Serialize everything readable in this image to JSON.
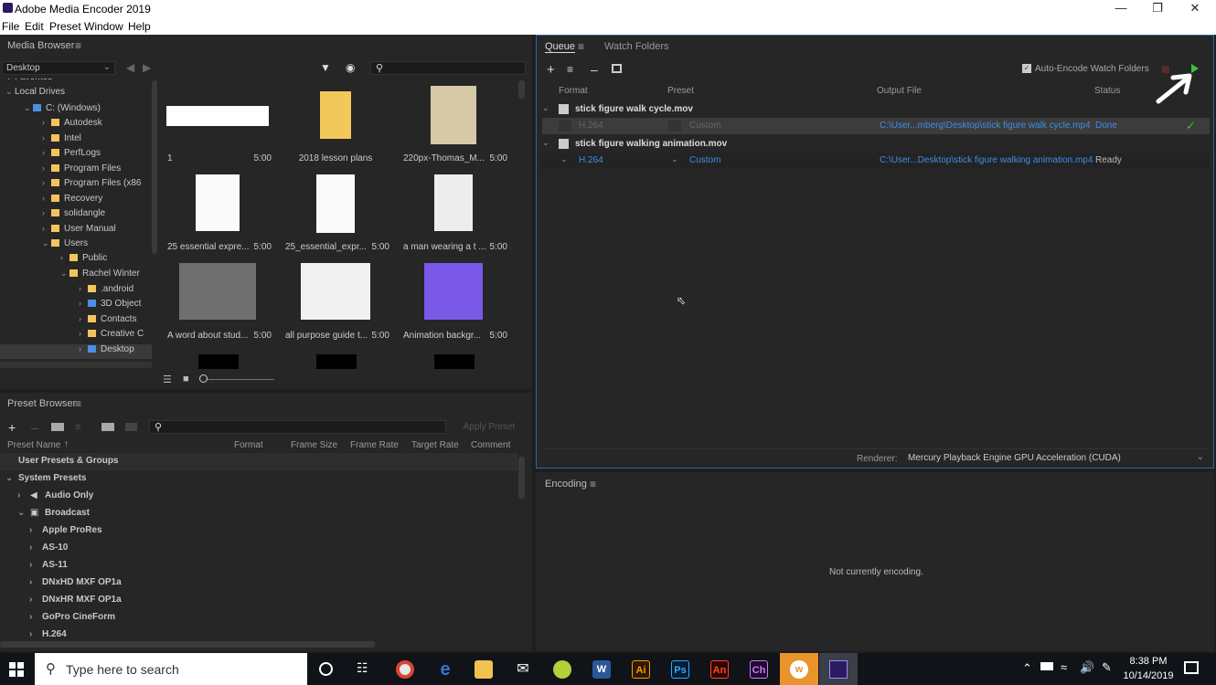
{
  "app": {
    "title": "Adobe Media Encoder 2019",
    "menu": [
      "File",
      "Edit",
      "Preset",
      "Window",
      "Help"
    ]
  },
  "media_browser": {
    "title": "Media Browser",
    "location": "Desktop",
    "tree": [
      {
        "label": "Favorites",
        "indent": 0
      },
      {
        "label": "Local Drives",
        "indent": 0
      },
      {
        "label": "C: (Windows)",
        "indent": 1
      },
      {
        "label": "Autodesk",
        "indent": 2
      },
      {
        "label": "Intel",
        "indent": 2
      },
      {
        "label": "PerfLogs",
        "indent": 2
      },
      {
        "label": "Program Files",
        "indent": 2
      },
      {
        "label": "Program Files (x86",
        "indent": 2
      },
      {
        "label": "Recovery",
        "indent": 2
      },
      {
        "label": "solidangle",
        "indent": 2
      },
      {
        "label": "User Manual",
        "indent": 2
      },
      {
        "label": "Users",
        "indent": 2
      },
      {
        "label": "Public",
        "indent": 3
      },
      {
        "label": "Rachel Winter",
        "indent": 3
      },
      {
        "label": ".android",
        "indent": 4
      },
      {
        "label": "3D Object",
        "indent": 4
      },
      {
        "label": "Contacts",
        "indent": 4
      },
      {
        "label": "Creative C",
        "indent": 4
      },
      {
        "label": "Desktop",
        "indent": 4
      }
    ],
    "thumbnails": [
      {
        "name": "1",
        "duration": "5:00"
      },
      {
        "name": "2018 lesson plans",
        "duration": ""
      },
      {
        "name": "220px-Thomas_M...",
        "duration": "5:00"
      },
      {
        "name": "25 essential expre...",
        "duration": "5:00"
      },
      {
        "name": "25_essential_expr...",
        "duration": "5:00"
      },
      {
        "name": "a man wearing a t ...",
        "duration": "5:00"
      },
      {
        "name": "A word about stud...",
        "duration": "5:00"
      },
      {
        "name": "all purpose guide t...",
        "duration": "5:00"
      },
      {
        "name": "Animation backgr...",
        "duration": "5:00"
      }
    ]
  },
  "queue": {
    "tabs": [
      "Queue",
      "Watch Folders"
    ],
    "auto_encode_label": "Auto-Encode Watch Folders",
    "columns": [
      "Format",
      "Preset",
      "Output File",
      "Status"
    ],
    "items": [
      {
        "source": "stick figure walk cycle.mov",
        "format": "H.264",
        "preset": "Custom",
        "output": "C:\\User...mberg\\Desktop\\stick figure walk cycle.mp4",
        "status": "Done"
      },
      {
        "source": "stick figure walking animation.mov",
        "format": "H.264",
        "preset": "Custom",
        "output": "C:\\User...Desktop\\stick figure walking animation.mp4",
        "status": "Ready"
      }
    ],
    "renderer_label": "Renderer:",
    "renderer_value": "Mercury Playback Engine GPU Acceleration (CUDA)"
  },
  "preset_browser": {
    "title": "Preset Browser",
    "apply_label": "Apply Preset",
    "columns": [
      "Preset Name",
      "Format",
      "Frame Size",
      "Frame Rate",
      "Target Rate",
      "Comment"
    ],
    "rows": [
      {
        "label": "User Presets & Groups",
        "indent": 0,
        "icon": ""
      },
      {
        "label": "System Presets",
        "indent": 0,
        "icon": ""
      },
      {
        "label": "Audio Only",
        "indent": 1,
        "icon": "speaker-icon"
      },
      {
        "label": "Broadcast",
        "indent": 1,
        "icon": "tv-icon"
      },
      {
        "label": "Apple ProRes",
        "indent": 2,
        "icon": ""
      },
      {
        "label": "AS-10",
        "indent": 2,
        "icon": ""
      },
      {
        "label": "AS-11",
        "indent": 2,
        "icon": ""
      },
      {
        "label": "DNxHD MXF OP1a",
        "indent": 2,
        "icon": ""
      },
      {
        "label": "DNxHR MXF OP1a",
        "indent": 2,
        "icon": ""
      },
      {
        "label": "GoPro CineForm",
        "indent": 2,
        "icon": ""
      },
      {
        "label": "H.264",
        "indent": 2,
        "icon": ""
      }
    ]
  },
  "encoding": {
    "title": "Encoding",
    "status": "Not currently encoding."
  },
  "taskbar": {
    "search_placeholder": "Type here to search",
    "time": "8:38 PM",
    "date": "10/14/2019"
  }
}
